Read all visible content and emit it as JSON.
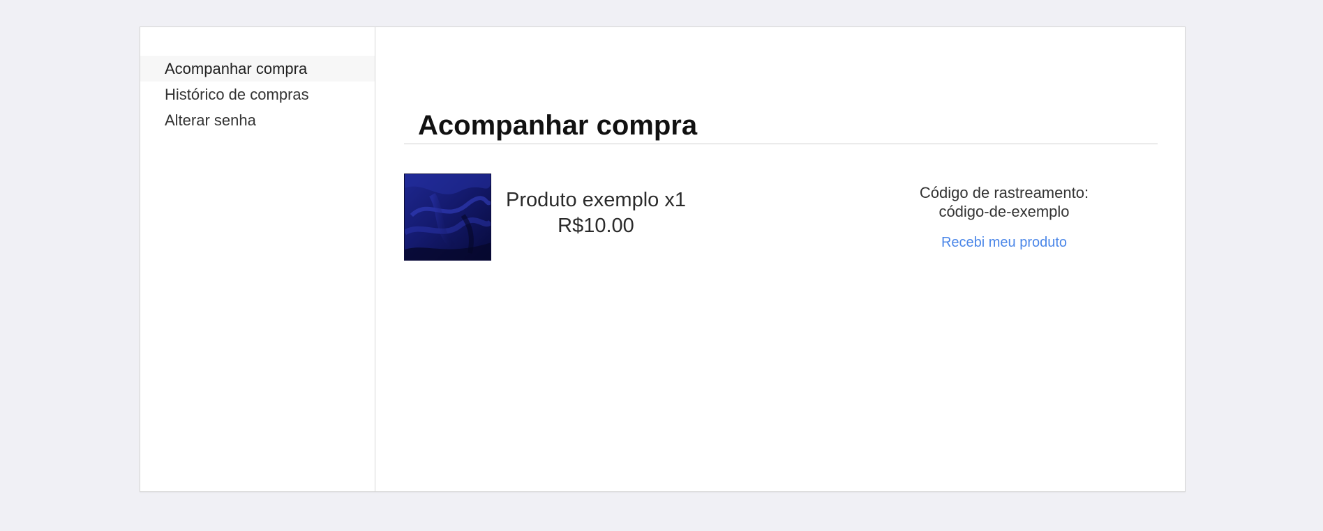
{
  "sidebar": {
    "items": [
      {
        "label": "Acompanhar compra",
        "active": true
      },
      {
        "label": "Histórico de compras",
        "active": false
      },
      {
        "label": "Alterar senha",
        "active": false
      }
    ]
  },
  "main": {
    "title": "Acompanhar compra",
    "order": {
      "product_name": "Produto exemplo x1",
      "price": "R$10.00",
      "image": "navy-silk-fabric-photo",
      "tracking_label": "Código de rastreamento:",
      "tracking_code": "código-de-exemplo",
      "received_link": "Recebi meu produto"
    }
  },
  "colors": {
    "background": "#f0f0f5",
    "link": "#4a86e8",
    "fabric": "#1a1f7a"
  }
}
